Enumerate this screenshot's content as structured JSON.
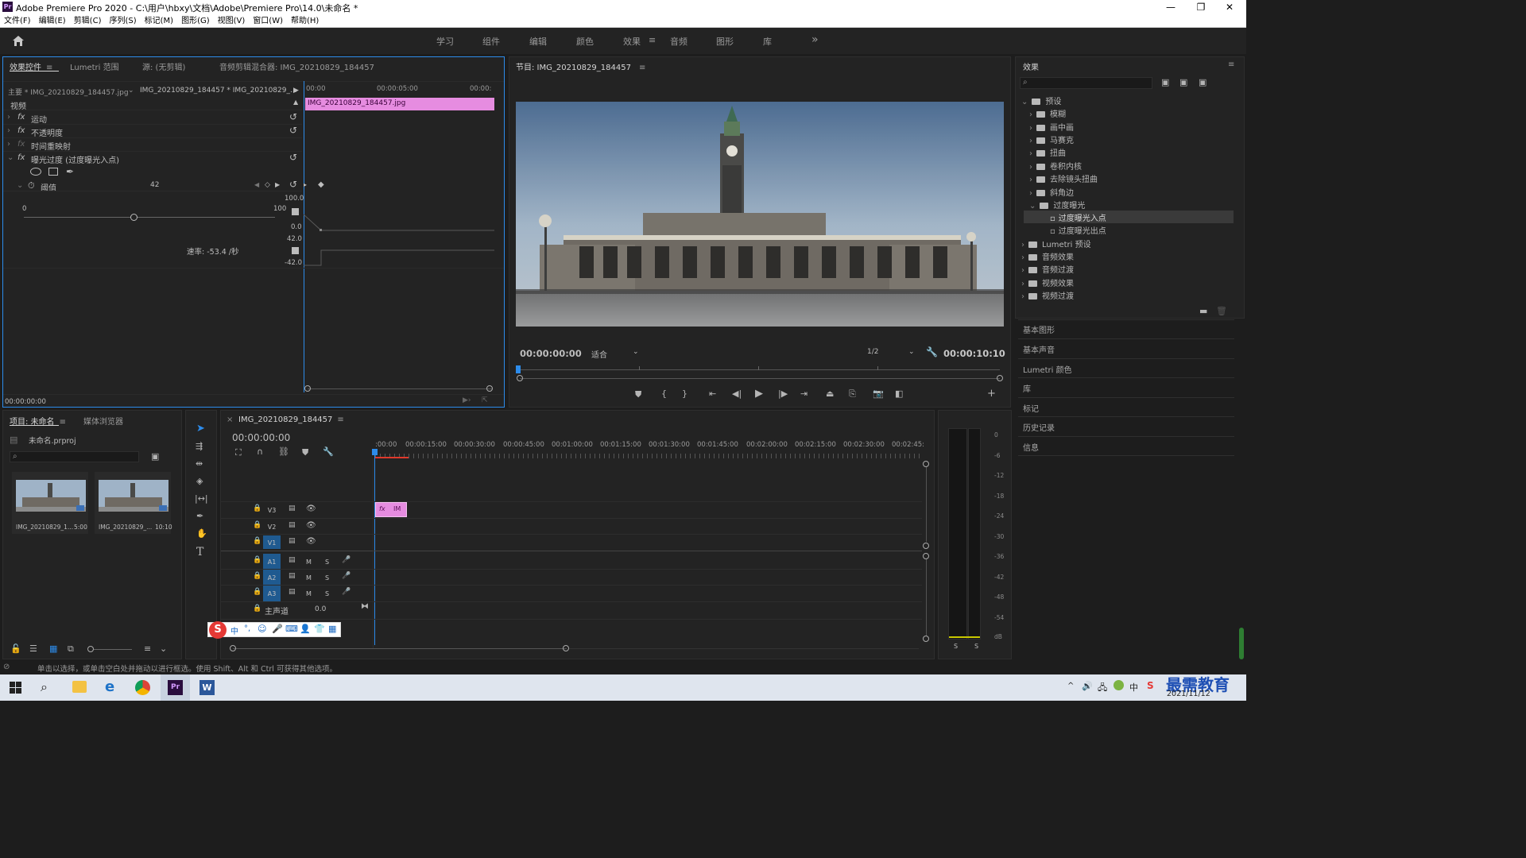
{
  "window": {
    "title": "Adobe Premiere Pro 2020 - C:\\用户\\hbxy\\文档\\Adobe\\Premiere Pro\\14.0\\未命名 *",
    "app_badge": "Pr",
    "minimize": "—",
    "restore": "❐",
    "close": "✕"
  },
  "menu": [
    "文件(F)",
    "编辑(E)",
    "剪辑(C)",
    "序列(S)",
    "标记(M)",
    "图形(G)",
    "视图(V)",
    "窗口(W)",
    "帮助(H)"
  ],
  "workspaces": {
    "items": [
      "学习",
      "组件",
      "编辑",
      "颜色",
      "效果",
      "音频",
      "图形",
      "库"
    ],
    "active": "效果",
    "more": "»"
  },
  "effect_controls": {
    "tabs": [
      "效果控件",
      "Lumetri 范围",
      "源: (无剪辑)",
      "音频剪辑混合器: IMG_20210829_184457"
    ],
    "master_label": "主要 * IMG_20210829_184457.jpg",
    "sequence_label": "IMG_20210829_184457 * IMG_20210829_...",
    "ruler": [
      "00:00",
      "00:00:05:00",
      "00:00:"
    ],
    "clip_name": "IMG_20210829_184457.jpg",
    "section_video": "视频",
    "effects": [
      "运动",
      "不透明度",
      "时间重映射",
      "曝光过度 (过度曝光入点)"
    ],
    "param_name": "阈值",
    "param_value": "42",
    "slider_min": "0",
    "slider_max": "100",
    "graph_values": [
      "100.0",
      "0.0",
      "42.0",
      "-42.0"
    ],
    "rate": "速率: -53.4 /秒",
    "timecode": "00:00:00:00"
  },
  "program_monitor": {
    "title": "节目: IMG_20210829_184457",
    "timecode": "00:00:00:00",
    "fit": "适合",
    "resolution": "1/2",
    "duration": "00:00:10:10",
    "colors": {
      "sky": "#a9bccd",
      "building": "#6f6a63",
      "ground": "#8b8c8c"
    }
  },
  "effects_panel": {
    "title": "效果",
    "tree": [
      {
        "label": "预设",
        "level": 0,
        "expanded": true
      },
      {
        "label": "模糊",
        "level": 1
      },
      {
        "label": "画中画",
        "level": 1
      },
      {
        "label": "马赛克",
        "level": 1
      },
      {
        "label": "扭曲",
        "level": 1
      },
      {
        "label": "卷积内核",
        "level": 1
      },
      {
        "label": "去除镜头扭曲",
        "level": 1
      },
      {
        "label": "斜角边",
        "level": 1
      },
      {
        "label": "过度曝光",
        "level": 1,
        "expanded": true
      },
      {
        "label": "过度曝光入点",
        "level": 2,
        "selected": true
      },
      {
        "label": "过度曝光出点",
        "level": 2
      },
      {
        "label": "Lumetri 预设",
        "level": 0
      },
      {
        "label": "音频效果",
        "level": 0
      },
      {
        "label": "音频过渡",
        "level": 0
      },
      {
        "label": "视频效果",
        "level": 0
      },
      {
        "label": "视频过渡",
        "level": 0
      }
    ],
    "side_panels": [
      "基本图形",
      "基本声音",
      "Lumetri 颜色",
      "库",
      "标记",
      "历史记录",
      "信息"
    ]
  },
  "project": {
    "tabs": [
      "项目: 未命名",
      "媒体浏览器"
    ],
    "file": "未命名.prproj",
    "items": [
      {
        "name": "IMG_20210829_1...",
        "duration": "5:00"
      },
      {
        "name": "IMG_20210829_...",
        "duration": "10:10"
      }
    ]
  },
  "timeline": {
    "tab": "IMG_20210829_184457",
    "timecode": "00:00:00:00",
    "ruler": [
      ":00:00",
      "00:00:15:00",
      "00:00:30:00",
      "00:00:45:00",
      "00:01:00:00",
      "00:01:15:00",
      "00:01:30:00",
      "00:01:45:00",
      "00:02:00:00",
      "00:02:15:00",
      "00:02:30:00",
      "00:02:45:"
    ],
    "video_tracks": [
      "V3",
      "V2",
      "V1"
    ],
    "audio_tracks": [
      "A1",
      "A2",
      "A3"
    ],
    "master_label": "主声道",
    "master_value": "0.0",
    "clip_label": "IM",
    "clip_fx": "fx",
    "m": "M",
    "s": "S"
  },
  "meter": {
    "scale": [
      "0",
      "-6",
      "-12",
      "-18",
      "-24",
      "-30",
      "-36",
      "-42",
      "-48",
      "-54",
      "dB"
    ],
    "solo": [
      "S",
      "S"
    ]
  },
  "status_bar": "单击以选择，或单击空白处并拖动以进行框选。使用 Shift、Alt 和 Ctrl 可获得其他选项。",
  "ime": {
    "brand": "S",
    "items": [
      "中",
      "°,",
      "☺",
      "🎤",
      "⌨",
      "👤",
      "👕",
      "▦"
    ]
  },
  "taskbar": {
    "date": "2021/11/12",
    "watermark": "最需教育",
    "tray": [
      "^",
      "🔊",
      "🖧",
      "中",
      "S"
    ]
  }
}
